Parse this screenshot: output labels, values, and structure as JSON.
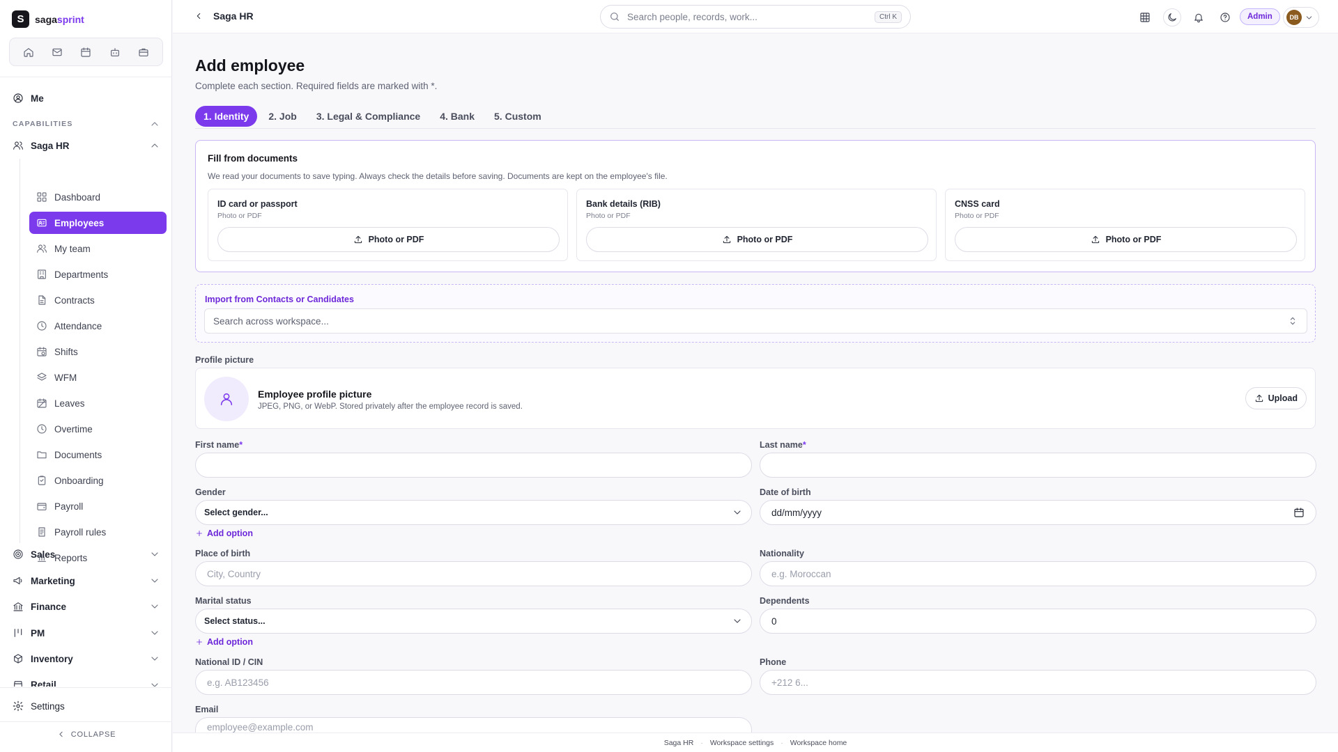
{
  "brand": {
    "mark": "S",
    "name_main": "saga",
    "name_accent": "sprint"
  },
  "sidebar": {
    "me": "Me",
    "capabilities_label": "CAPABILITIES",
    "saga_hr": "Saga HR",
    "hr_items": [
      {
        "label": "Dashboard",
        "icon": "dashboard-icon"
      },
      {
        "label": "Employees",
        "icon": "id-card-icon",
        "active": true
      },
      {
        "label": "My team",
        "icon": "users-icon"
      },
      {
        "label": "Departments",
        "icon": "building-icon"
      },
      {
        "label": "Contracts",
        "icon": "file-icon"
      },
      {
        "label": "Attendance",
        "icon": "clock-icon"
      },
      {
        "label": "Shifts",
        "icon": "calendar-clock-icon"
      },
      {
        "label": "WFM",
        "icon": "layers-icon"
      },
      {
        "label": "Leaves",
        "icon": "calendar-off-icon"
      },
      {
        "label": "Overtime",
        "icon": "clock-icon"
      },
      {
        "label": "Documents",
        "icon": "folder-icon"
      },
      {
        "label": "Onboarding",
        "icon": "clipboard-icon"
      },
      {
        "label": "Payroll",
        "icon": "wallet-icon"
      },
      {
        "label": "Payroll rules",
        "icon": "file-rules-icon"
      },
      {
        "label": "Reports",
        "icon": "bar-chart-icon"
      }
    ],
    "groups": [
      {
        "label": "Sales",
        "icon": "target-icon"
      },
      {
        "label": "Marketing",
        "icon": "megaphone-icon"
      },
      {
        "label": "Finance",
        "icon": "bank-icon"
      },
      {
        "label": "PM",
        "icon": "kanban-icon"
      },
      {
        "label": "Inventory",
        "icon": "box-icon"
      },
      {
        "label": "Retail",
        "icon": "store-icon"
      }
    ],
    "settings": "Settings",
    "collapse": "COLLAPSE"
  },
  "topbar": {
    "breadcrumb": "Saga HR",
    "search_placeholder": "Search people, records, work...",
    "search_shortcut": "Ctrl K",
    "role_badge": "Admin",
    "avatar_initials": "DB"
  },
  "page": {
    "title": "Add employee",
    "subtitle": "Complete each section. Required fields are marked with *.",
    "tabs": [
      "1. Identity",
      "2. Job",
      "3. Legal & Compliance",
      "4. Bank",
      "5. Custom"
    ],
    "active_tab": 0
  },
  "documents": {
    "title": "Fill from documents",
    "description": "We read your documents to save typing. Always check the details before saving. Documents are kept on the employee's file.",
    "cards": [
      {
        "title": "ID card or passport",
        "hint": "Photo or PDF",
        "button": "Photo or PDF"
      },
      {
        "title": "Bank details (RIB)",
        "hint": "Photo or PDF",
        "button": "Photo or PDF"
      },
      {
        "title": "CNSS card",
        "hint": "Photo or PDF",
        "button": "Photo or PDF"
      }
    ]
  },
  "import": {
    "label": "Import from Contacts or Candidates",
    "placeholder": "Search across workspace..."
  },
  "profile_picture": {
    "section_label": "Profile picture",
    "title": "Employee profile picture",
    "description": "JPEG, PNG, or WebP. Stored privately after the employee record is saved.",
    "upload": "Upload"
  },
  "form": {
    "first_name_label": "First name",
    "last_name_label": "Last name",
    "required_mark": "*",
    "gender_label": "Gender",
    "gender_value": "Select gender...",
    "dob_label": "Date of birth",
    "dob_value": "dd/mm/yyyy",
    "add_option": "Add option",
    "place_of_birth_label": "Place of birth",
    "place_of_birth_placeholder": "City, Country",
    "nationality_label": "Nationality",
    "nationality_placeholder": "e.g. Moroccan",
    "marital_label": "Marital status",
    "marital_value": "Select status...",
    "dependents_label": "Dependents",
    "dependents_value": "0",
    "national_id_label": "National ID / CIN",
    "national_id_placeholder": "e.g. AB123456",
    "phone_label": "Phone",
    "phone_placeholder": "+212 6...",
    "email_label": "Email",
    "email_placeholder": "employee@example.com"
  },
  "footer": {
    "links": [
      "Saga HR",
      "Workspace settings",
      "Workspace home"
    ]
  },
  "colors": {
    "accent": "#7c3aed",
    "accent_border": "#c9b6f5"
  }
}
